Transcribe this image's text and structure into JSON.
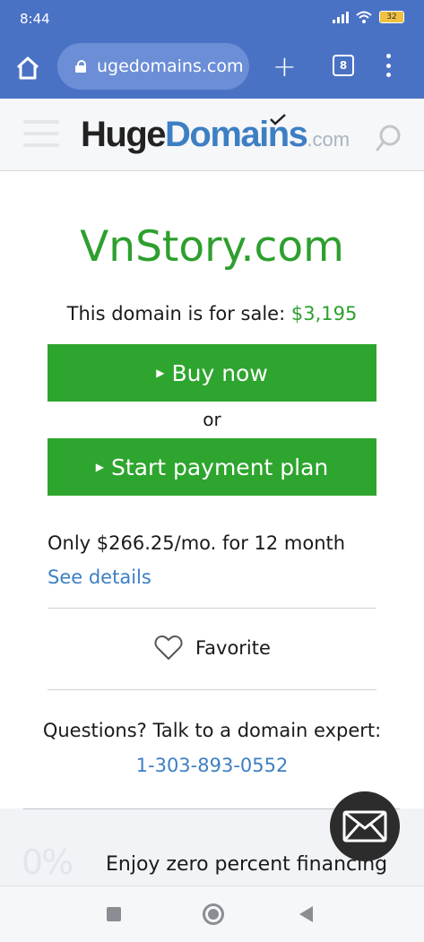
{
  "status_bar": {
    "time": "8:44",
    "battery": "32"
  },
  "browser": {
    "url": "ugedomains.com",
    "tab_count": "8"
  },
  "site": {
    "logo_huge": "Huge",
    "logo_domains": "Domains",
    "logo_dotcom": ".com"
  },
  "listing": {
    "domain": "VnStory.com",
    "sale_text": "This domain is for sale:",
    "price": "$3,195",
    "buy_label": "Buy now",
    "or_text": "or",
    "plan_label": "Start payment plan",
    "monthly_text": "Only $266.25/mo. for 12 month",
    "see_details": "See details",
    "favorite_label": "Favorite",
    "questions_text": "Questions? Talk to a domain expert:",
    "phone": "1-303-893-0552"
  },
  "finance": {
    "badge": "0%",
    "text": "Enjoy zero percent financing"
  },
  "colors": {
    "brand_blue": "#4a72c4",
    "green": "#2ea52e",
    "link_blue": "#3d7fc4"
  },
  "icons": [
    "home-icon",
    "lock-icon",
    "plus-icon",
    "tabs-icon",
    "menu-icon",
    "hamburger-icon",
    "search-icon",
    "heart-icon",
    "mail-icon"
  ]
}
